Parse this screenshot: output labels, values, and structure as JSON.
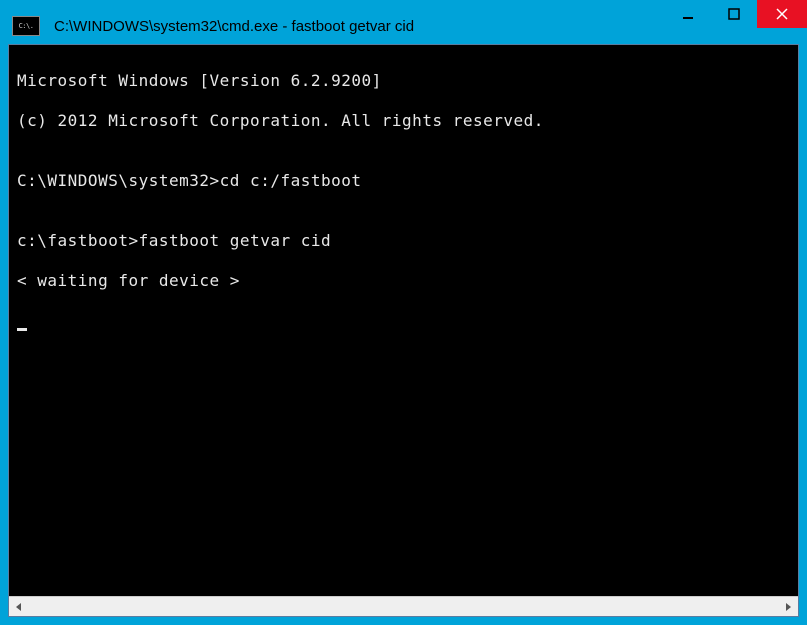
{
  "window": {
    "title": "C:\\WINDOWS\\system32\\cmd.exe - fastboot  getvar cid",
    "icon_label": "C:\\."
  },
  "terminal": {
    "lines": [
      "Microsoft Windows [Version 6.2.9200]",
      "(c) 2012 Microsoft Corporation. All rights reserved.",
      "",
      "C:\\WINDOWS\\system32>cd c:/fastboot",
      "",
      "c:\\fastboot>fastboot getvar cid",
      "< waiting for device >"
    ]
  }
}
